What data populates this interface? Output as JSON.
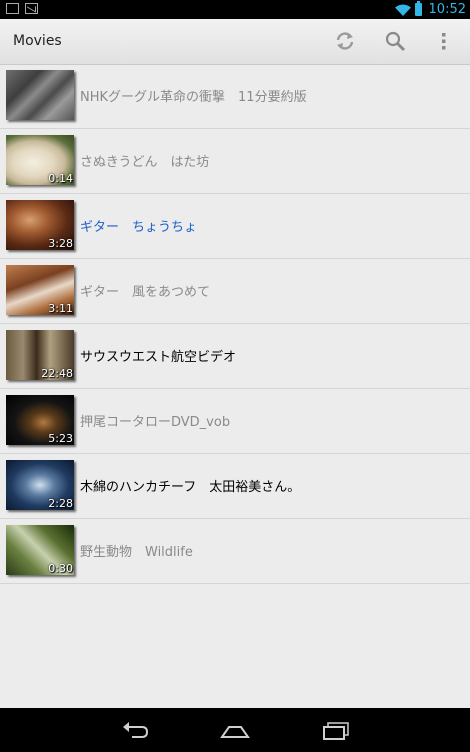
{
  "status_bar": {
    "time": "10:52",
    "accent_color": "#33b5e5",
    "icons": [
      "gallery-icon",
      "gmail-icon",
      "wifi-icon",
      "battery-icon"
    ]
  },
  "action_bar": {
    "title": "Movies",
    "actions": [
      {
        "name": "refresh-icon"
      },
      {
        "name": "search-icon"
      },
      {
        "name": "overflow-menu-icon"
      }
    ]
  },
  "videos": [
    {
      "title": "NHKグーグル革命の衝撃　11分要約版",
      "duration": "",
      "state": "watched"
    },
    {
      "title": "さぬきうどん　はた坊",
      "duration": "0:14",
      "state": "watched"
    },
    {
      "title": "ギター　ちょうちょ",
      "duration": "3:28",
      "state": "current"
    },
    {
      "title": "ギター　風をあつめて",
      "duration": "3:11",
      "state": "watched"
    },
    {
      "title": "サウスウエスト航空ビデオ",
      "duration": "22:48",
      "state": "new"
    },
    {
      "title": "押尾コータローDVD_vob",
      "duration": "5:23",
      "state": "watched"
    },
    {
      "title": "木綿のハンカチーフ　太田裕美さん。",
      "duration": "2:28",
      "state": "new"
    },
    {
      "title": "野生動物　Wildlife",
      "duration": "0:30",
      "state": "watched"
    }
  ],
  "colors": {
    "current": "#1a5fc9",
    "watched": "#8a8a8a",
    "new": "#000000"
  },
  "nav_bar": {
    "buttons": [
      "back-icon",
      "home-icon",
      "recent-apps-icon"
    ]
  }
}
